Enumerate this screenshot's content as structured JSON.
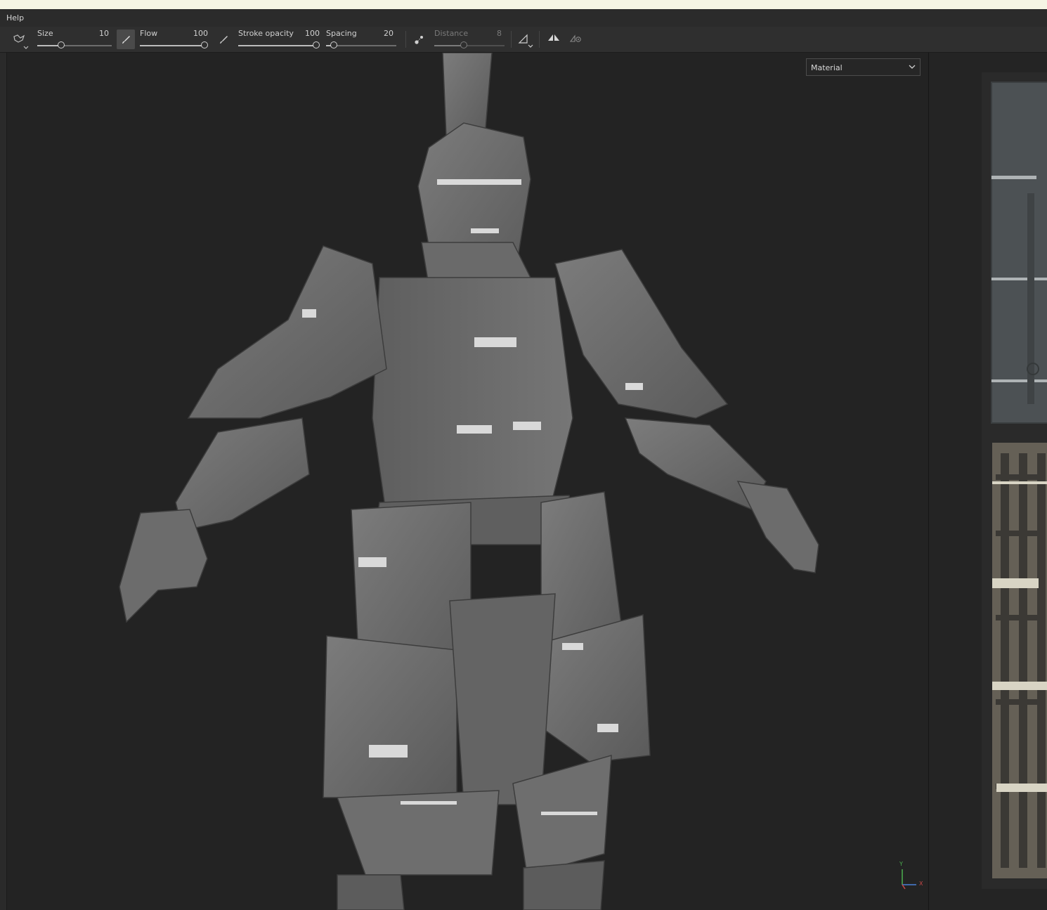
{
  "menu": {
    "help": "Help"
  },
  "toolbar": {
    "size": {
      "label": "Size",
      "value": "10",
      "fraction": 0.3
    },
    "flow": {
      "label": "Flow",
      "value": "100",
      "fraction": 1.0
    },
    "stroke_opacity": {
      "label": "Stroke opacity",
      "value": "100",
      "fraction": 1.0
    },
    "spacing": {
      "label": "Spacing",
      "value": "20",
      "fraction": 0.1
    },
    "distance": {
      "label": "Distance",
      "value": "8",
      "fraction": 0.4
    }
  },
  "viewport": {
    "channel_select": "Material",
    "axis_y": "Y",
    "axis_x": "X"
  },
  "colors": {
    "menubar_top": "#f5f5e4",
    "background": "#232323",
    "toolbar": "#2f2f2f",
    "model_grey": "#6e6e6e"
  },
  "icons": [
    "brush-preset-icon",
    "flow-brush-icon",
    "stroke-opacity-brush-icon",
    "lazy-mouse-icon",
    "alignment-icon",
    "symmetry-icon",
    "symmetry-settings-icon",
    "axis-gizmo-icon"
  ]
}
